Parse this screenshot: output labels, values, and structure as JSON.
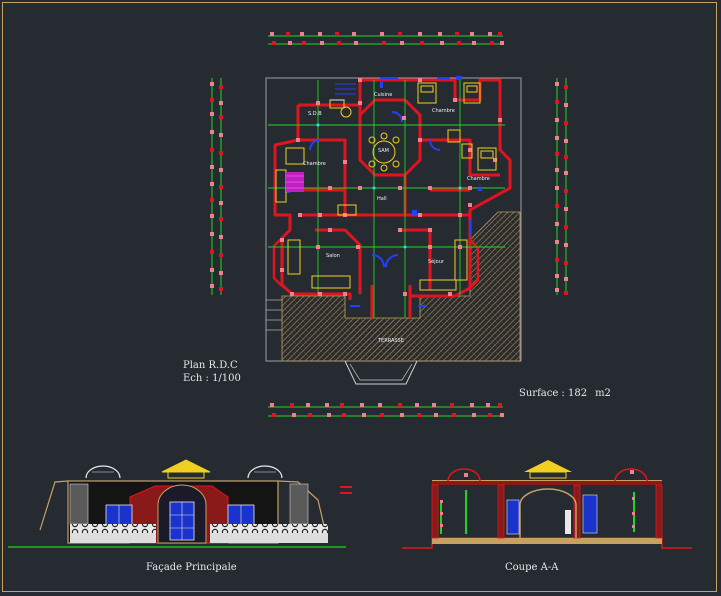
{
  "title_block": {
    "plan_title": "Plan R.D.C",
    "scale": "Ech : 1/100"
  },
  "surface": {
    "label": "Surface : 182",
    "unit": "m2"
  },
  "views": {
    "facade_title": "Façade Principale",
    "section_title": "Coupe A-A"
  },
  "rooms": {
    "sdb": "S.D.B",
    "cuisine": "Cuisine",
    "chambre1": "Chambre",
    "chambre2": "Chambre",
    "chambre3": "Chambre",
    "sam": "SAM",
    "hall": "Hall",
    "salon": "Salon",
    "sejour": "Séjour",
    "terrasse": "TERRASSE"
  },
  "colors": {
    "background": "#262b31",
    "frame": "#c8a060",
    "walls": "#e0141e",
    "dimension": "#22d422",
    "furniture": "#f0d020",
    "windows": "#2040ff",
    "hatch": "#8a7040"
  }
}
